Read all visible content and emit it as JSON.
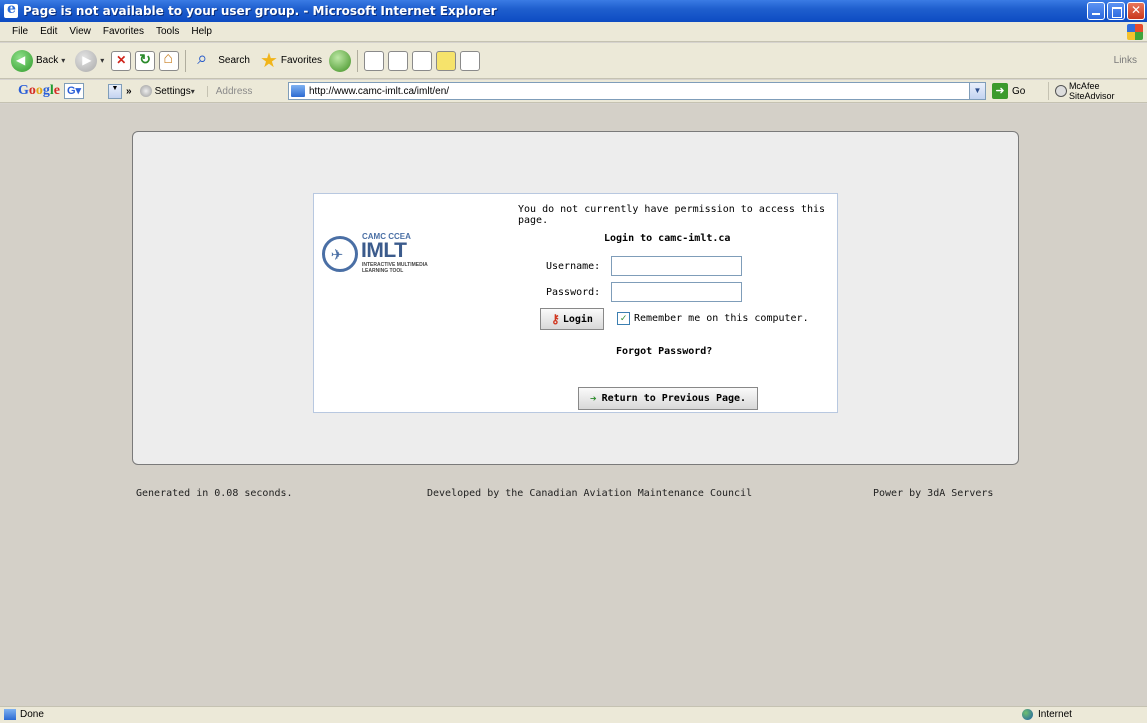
{
  "window": {
    "title": "Page is not available to your user group. - Microsoft Internet Explorer"
  },
  "menu": [
    "File",
    "Edit",
    "View",
    "Favorites",
    "Tools",
    "Help"
  ],
  "toolbar": {
    "back": "Back",
    "search": "Search",
    "favorites": "Favorites",
    "links": "Links"
  },
  "googlebar": {
    "settings": "Settings",
    "address_label": "Address",
    "url": "http://www.camc-imlt.ca/imlt/en/",
    "go": "Go",
    "mcafee": "McAfee SiteAdvisor"
  },
  "logo": {
    "top": "CAMC CCEA",
    "big": "IMLT",
    "sub1": "INTERACTIVE MULTIMEDIA",
    "sub2": "LEARNING TOOL"
  },
  "login": {
    "permission_msg": "You do not currently have permission to access this page.",
    "title": "Login to camc-imlt.ca",
    "username_label": "Username:",
    "username_value": "",
    "password_label": "Password:",
    "password_value": "",
    "login_button": "Login",
    "remember_label": "Remember me on this computer.",
    "remember_checked": true,
    "forgot": "Forgot Password?",
    "return_button": "Return to Previous Page."
  },
  "footer": {
    "generated": "Generated in 0.08 seconds.",
    "developed": "Developed by the Canadian Aviation Maintenance Council",
    "power": "Power by 3dA Servers"
  },
  "status": {
    "left": "Done",
    "zone": "Internet"
  },
  "colors": {
    "titlebar": "#0d4bc2",
    "chrome": "#ece9d8",
    "content_bg": "#d4d0c8",
    "panel_bg": "#ededed",
    "login_border": "#b8c8e0"
  }
}
